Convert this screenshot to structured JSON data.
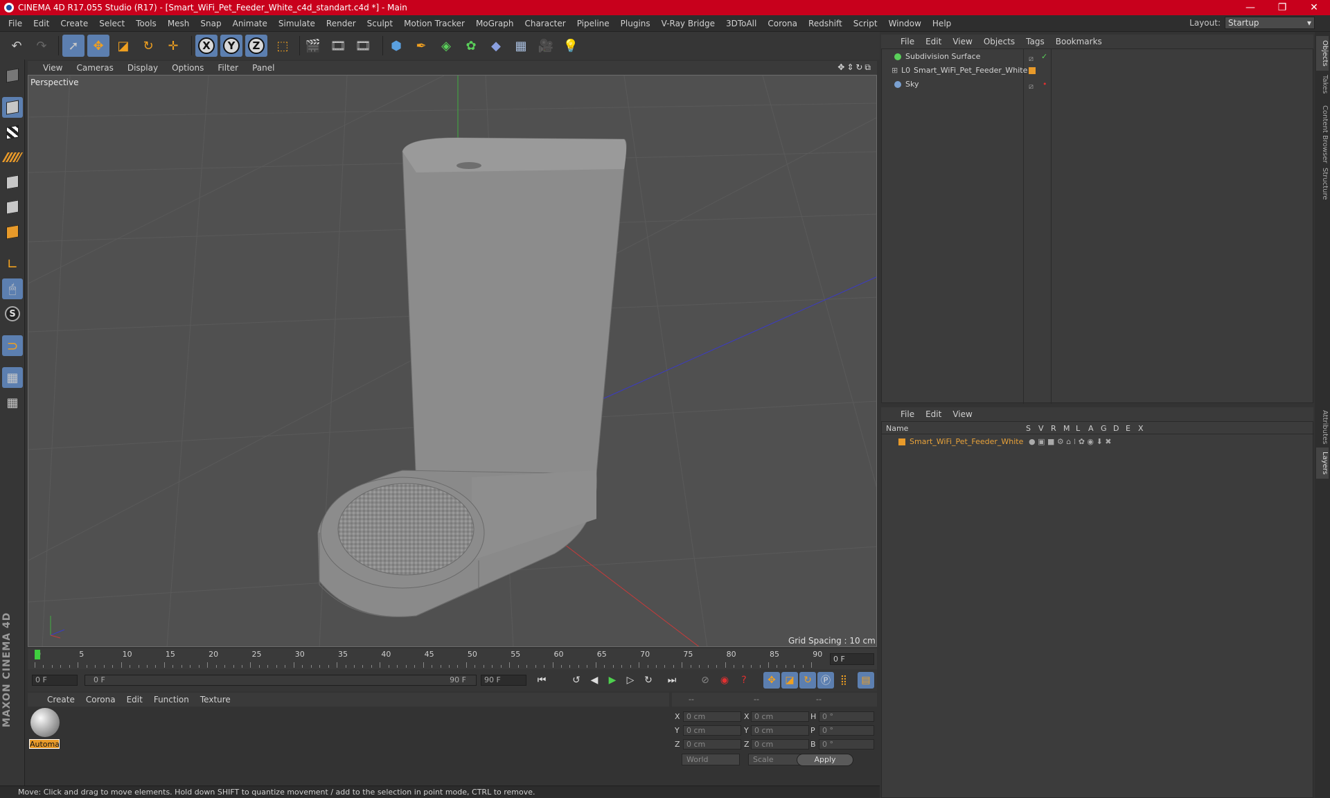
{
  "window": {
    "title": "CINEMA 4D R17.055 Studio (R17) - [Smart_WiFi_Pet_Feeder_White_c4d_standart.c4d *] - Main",
    "controls": {
      "minimize": "—",
      "restore": "❐",
      "close": "✕"
    }
  },
  "menu": {
    "items": [
      "File",
      "Edit",
      "Create",
      "Select",
      "Tools",
      "Mesh",
      "Snap",
      "Animate",
      "Simulate",
      "Render",
      "Sculpt",
      "Motion Tracker",
      "MoGraph",
      "Character",
      "Pipeline",
      "Plugins",
      "V-Ray Bridge",
      "3DToAll",
      "Corona",
      "Redshift",
      "Script",
      "Window",
      "Help"
    ],
    "layout_label": "Layout:",
    "layout_value": "Startup"
  },
  "viewport": {
    "menu": [
      "View",
      "Cameras",
      "Display",
      "Options",
      "Filter",
      "Panel"
    ],
    "label": "Perspective",
    "grid_spacing": "Grid Spacing : 10 cm",
    "nav_icons": "✥⇕↻⧉"
  },
  "timeline": {
    "ticks": [
      "0",
      "5",
      "10",
      "15",
      "20",
      "25",
      "30",
      "35",
      "40",
      "45",
      "50",
      "55",
      "60",
      "65",
      "70",
      "75",
      "80",
      "85",
      "90"
    ],
    "current_frame": "0 F"
  },
  "transport": {
    "start": "0 F",
    "range_start": "0 F",
    "range_end": "90 F",
    "end": "90 F"
  },
  "material": {
    "menu": [
      "Create",
      "Corona",
      "Edit",
      "Function",
      "Texture"
    ],
    "name": "Automa"
  },
  "coordinates": {
    "headers": [
      "--",
      "--",
      "--"
    ],
    "rows": [
      {
        "axis": "X",
        "pos": "0 cm",
        "axis2": "X",
        "size": "0 cm",
        "rot_label": "H",
        "rot": "0 °"
      },
      {
        "axis": "Y",
        "pos": "0 cm",
        "axis2": "Y",
        "size": "0 cm",
        "rot_label": "P",
        "rot": "0 °"
      },
      {
        "axis": "Z",
        "pos": "0 cm",
        "axis2": "Z",
        "size": "0 cm",
        "rot_label": "B",
        "rot": "0 °"
      }
    ],
    "mode1": "World",
    "mode2": "Scale",
    "apply": "Apply"
  },
  "status": "Move: Click and drag to move elements. Hold down SHIFT to quantize movement / add to the selection in point mode, CTRL to remove.",
  "objects": {
    "menu": [
      "File",
      "Edit",
      "View",
      "Objects",
      "Tags",
      "Bookmarks"
    ],
    "items": [
      {
        "name": "Subdivision Surface"
      },
      {
        "name": "Smart_WiFi_Pet_Feeder_White"
      },
      {
        "name": "Sky"
      }
    ]
  },
  "layers": {
    "menu": [
      "File",
      "Edit",
      "View"
    ],
    "columns": [
      "Name",
      "S",
      "V",
      "R",
      "M",
      "L",
      "A",
      "G",
      "D",
      "E",
      "X"
    ],
    "row_name": "Smart_WiFi_Pet_Feeder_White"
  },
  "right_tabs": [
    "Objects",
    "Takes",
    "Content Browser",
    "Structure",
    "Attributes",
    "Layers"
  ],
  "brand": "MAXON CINEMA 4D",
  "colors": {
    "title_bar": "#c8001c",
    "accent_blue": "#5c7fb0",
    "accent_orange": "#e89a2a"
  }
}
